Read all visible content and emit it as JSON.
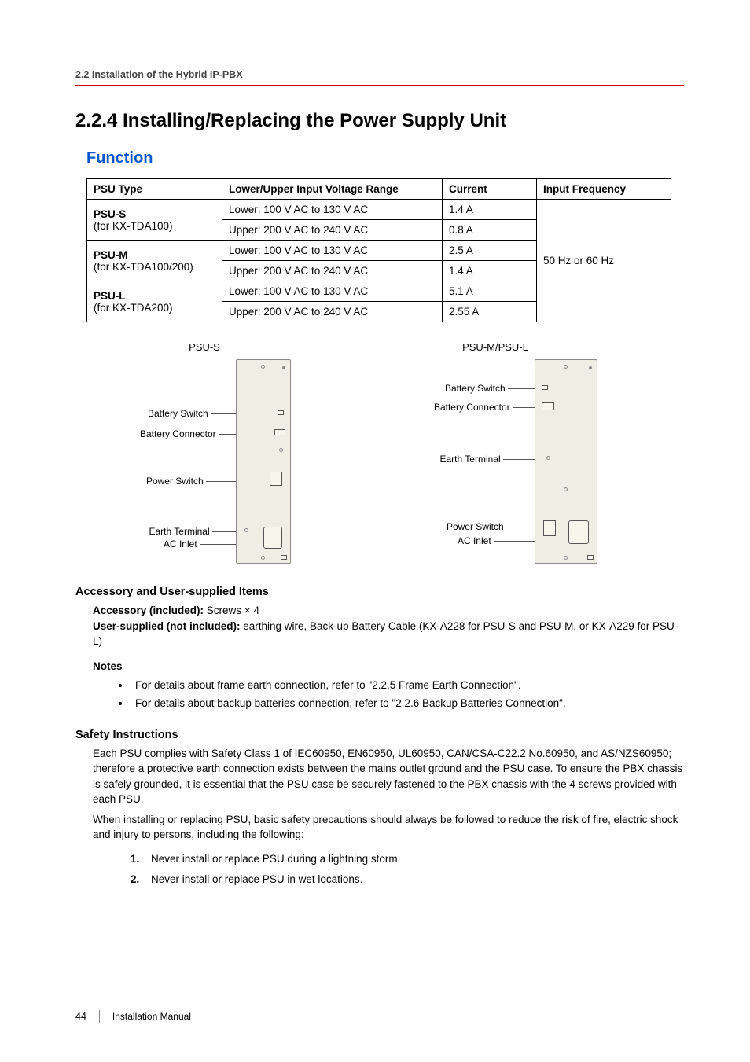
{
  "header": {
    "section_path": "2.2 Installation of the Hybrid IP-PBX"
  },
  "title": "2.2.4   Installing/Replacing the Power Supply Unit",
  "function_heading": "Function",
  "table": {
    "headers": [
      "PSU Type",
      "Lower/Upper Input Voltage Range",
      "Current",
      "Input Frequency"
    ],
    "rows": [
      {
        "type_label": "PSU-S",
        "type_note": "(for KX-TDA100)",
        "range": "Lower: 100 V AC to 130 V AC",
        "current": "1.4 A"
      },
      {
        "range": "Upper: 200 V AC to 240 V AC",
        "current": "0.8 A"
      },
      {
        "type_label": "PSU-M",
        "type_note": "(for KX-TDA100/200)",
        "range": "Lower: 100 V AC to 130 V AC",
        "current": "2.5 A"
      },
      {
        "range": "Upper: 200 V AC to 240 V AC",
        "current": "1.4 A"
      },
      {
        "type_label": "PSU-L",
        "type_note": "(for KX-TDA200)",
        "range": "Lower: 100 V AC to 130 V AC",
        "current": "5.1 A"
      },
      {
        "range": "Upper: 200 V AC to 240 V AC",
        "current": "2.55 A"
      }
    ],
    "freq": "50 Hz or 60 Hz"
  },
  "diagrams": {
    "left_title": "PSU-S",
    "right_title": "PSU-M/PSU-L",
    "labels_s": {
      "battery_switch": "Battery Switch",
      "battery_connector": "Battery Connector",
      "power_switch": "Power Switch",
      "earth_terminal": "Earth Terminal",
      "ac_inlet": "AC Inlet"
    },
    "labels_ml": {
      "battery_switch": "Battery Switch",
      "battery_connector": "Battery Connector",
      "earth_terminal": "Earth Terminal",
      "power_switch": "Power Switch",
      "ac_inlet": "AC Inlet"
    }
  },
  "accessory": {
    "heading": "Accessory and User-supplied Items",
    "included_label": "Accessory (included): ",
    "included_text": "Screws × 4",
    "user_label": "User-supplied (not included): ",
    "user_text": "earthing wire, Back-up Battery Cable (KX-A228 for PSU-S and PSU-M, or KX-A229 for PSU-L)"
  },
  "notes": {
    "heading": "Notes",
    "items": [
      "For details about frame earth connection, refer to \"2.2.5 Frame Earth Connection\".",
      "For details about backup batteries connection, refer to \"2.2.6 Backup Batteries Connection\"."
    ]
  },
  "safety": {
    "heading": "Safety Instructions",
    "p1": "Each PSU complies with Safety Class 1 of IEC60950, EN60950, UL60950, CAN/CSA-C22.2 No.60950, and AS/NZS60950; therefore a protective earth connection exists between the mains outlet ground and the PSU case. To ensure the PBX chassis is safely grounded, it is essential that the PSU case be securely fastened to the PBX chassis with the 4 screws provided with each PSU.",
    "p2": "When installing or replacing PSU, basic safety precautions should always be followed to reduce the risk of fire, electric shock and injury to persons, including the following:",
    "items": [
      "Never install or replace PSU during a lightning storm.",
      "Never install or replace PSU in wet locations."
    ]
  },
  "footer": {
    "page": "44",
    "label": "Installation Manual"
  }
}
